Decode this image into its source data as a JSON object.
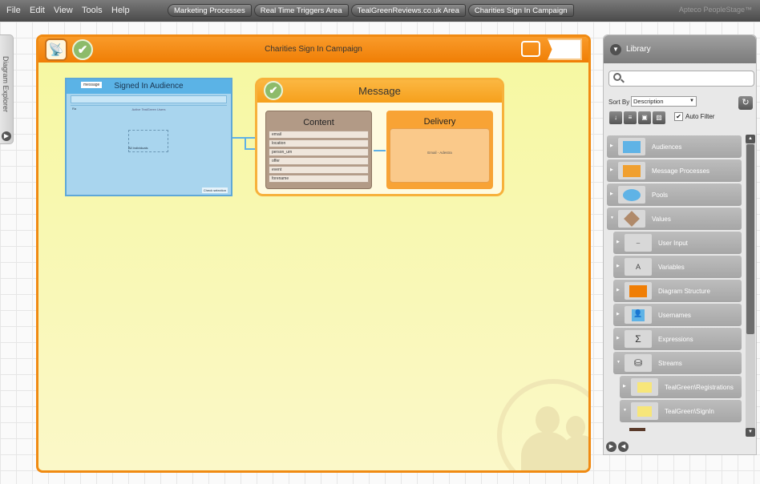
{
  "menu": {
    "file": "File",
    "edit": "Edit",
    "view": "View",
    "tools": "Tools",
    "help": "Help"
  },
  "breadcrumbs": [
    "Marketing Processes",
    "Real Time Triggers Area",
    "TealGreenReviews.co.uk Area",
    "Charities Sign In Campaign"
  ],
  "brand": "Apteco PeopleStage™",
  "explorer": {
    "label": "Diagram Explorer"
  },
  "campaign": {
    "title": "Charities Sign In Campaign"
  },
  "audience": {
    "title": "Signed In Audience",
    "tag": "message",
    "inner_title": "Active TealGreen Users",
    "inner_label": "Ra",
    "box_label": "All Individuals",
    "footer": "Check selection"
  },
  "message": {
    "title": "Message",
    "content_title": "Content",
    "content_rows": [
      "email",
      "location",
      "person_urn",
      "offer",
      "event",
      "forename"
    ],
    "delivery_title": "Delivery",
    "delivery_label": "Email - Adestra"
  },
  "library": {
    "title": "Library",
    "search_placeholder": "",
    "sort_label": "Sort By",
    "sort_value": "Description",
    "auto_filter": "Auto Filter",
    "items": [
      {
        "label": "Audiences",
        "icon": "audience-icon",
        "color": "#5fb3e6"
      },
      {
        "label": "Message Processes",
        "icon": "message-process-icon",
        "color": "#f0a030"
      },
      {
        "label": "Pools",
        "icon": "pool-icon",
        "color": "#5fb3e6"
      },
      {
        "label": "Values",
        "icon": "tag-icon",
        "color": "#b08a6a"
      },
      {
        "label": "User Input",
        "icon": "user-input-icon",
        "color": "#666666"
      },
      {
        "label": "Variables",
        "icon": "variables-icon",
        "color": "#666666"
      },
      {
        "label": "Diagram Structure",
        "icon": "diagram-structure-icon",
        "color": "#f07e05"
      },
      {
        "label": "Usernames",
        "icon": "user-icon",
        "color": "#5fb3e6"
      },
      {
        "label": "Expressions",
        "icon": "sigma-icon",
        "color": "#444444"
      },
      {
        "label": "Streams",
        "icon": "database-icon",
        "color": "#444444"
      },
      {
        "label": "TealGreen\\Registrations",
        "icon": "folder-icon",
        "color": "#f7e67a"
      },
      {
        "label": "TealGreen\\SignIn",
        "icon": "folder-icon",
        "color": "#f7e67a"
      }
    ]
  }
}
